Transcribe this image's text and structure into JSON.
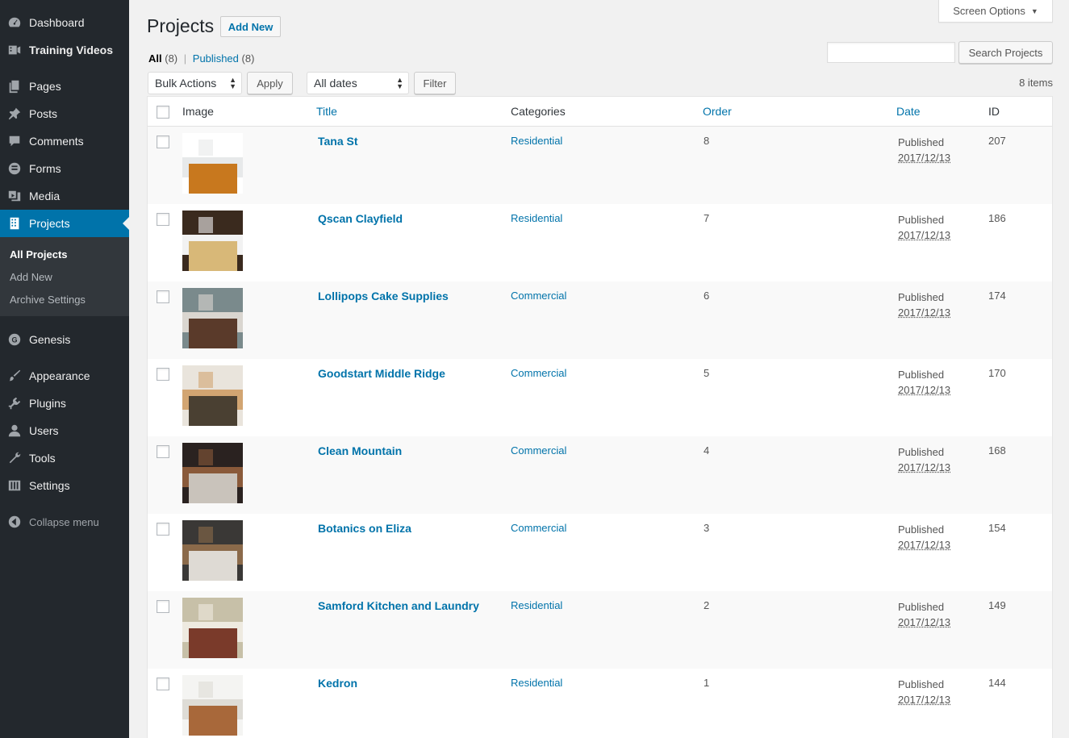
{
  "sidebar": {
    "items": [
      {
        "label": "Dashboard",
        "icon": "dashboard-icon"
      },
      {
        "label": "Training Videos",
        "icon": "video-icon"
      },
      {
        "label": "Pages",
        "icon": "pages-icon"
      },
      {
        "label": "Posts",
        "icon": "pin-icon"
      },
      {
        "label": "Comments",
        "icon": "comment-icon"
      },
      {
        "label": "Forms",
        "icon": "forms-icon"
      },
      {
        "label": "Media",
        "icon": "media-icon"
      },
      {
        "label": "Projects",
        "icon": "projects-icon"
      },
      {
        "label": "Genesis",
        "icon": "genesis-icon"
      },
      {
        "label": "Appearance",
        "icon": "brush-icon"
      },
      {
        "label": "Plugins",
        "icon": "plugin-icon"
      },
      {
        "label": "Users",
        "icon": "user-icon"
      },
      {
        "label": "Tools",
        "icon": "wrench-icon"
      },
      {
        "label": "Settings",
        "icon": "settings-icon"
      }
    ],
    "submenu": [
      "All Projects",
      "Add New",
      "Archive Settings"
    ],
    "collapse_label": "Collapse menu"
  },
  "header": {
    "title": "Projects",
    "add_new": "Add New",
    "screen_options": "Screen Options"
  },
  "filters": {
    "all_label": "All",
    "all_count": "(8)",
    "sep": "|",
    "published_label": "Published",
    "published_count": "(8)"
  },
  "search": {
    "placeholder": "",
    "button": "Search Projects"
  },
  "toolbar": {
    "bulk_actions": "Bulk Actions",
    "apply": "Apply",
    "dates": "All dates",
    "filter": "Filter",
    "items_count": "8 items"
  },
  "columns": {
    "image": "Image",
    "title": "Title",
    "categories": "Categories",
    "order": "Order",
    "date": "Date",
    "id": "ID"
  },
  "rows": [
    {
      "title": "Tana St",
      "category": "Residential",
      "order": "8",
      "status": "Published",
      "date": "2017/12/13",
      "id": "207",
      "palette": [
        "#ffffff",
        "#e7e9ea",
        "#c8781e"
      ]
    },
    {
      "title": "Qscan Clayfield",
      "category": "Residential",
      "order": "7",
      "status": "Published",
      "date": "2017/12/13",
      "id": "186",
      "palette": [
        "#3a2a1e",
        "#f2f2f2",
        "#d8b878"
      ]
    },
    {
      "title": "Lollipops Cake Supplies",
      "category": "Commercial",
      "order": "6",
      "status": "Published",
      "date": "2017/12/13",
      "id": "174",
      "palette": [
        "#7a8a8c",
        "#dad6d0",
        "#5a3a2a"
      ]
    },
    {
      "title": "Goodstart Middle Ridge",
      "category": "Commercial",
      "order": "5",
      "status": "Published",
      "date": "2017/12/13",
      "id": "170",
      "palette": [
        "#e9e4dc",
        "#d2a572",
        "#4a4032"
      ]
    },
    {
      "title": "Clean Mountain",
      "category": "Commercial",
      "order": "4",
      "status": "Published",
      "date": "2017/12/13",
      "id": "168",
      "palette": [
        "#2a2220",
        "#8a5a3a",
        "#c9c3bb"
      ]
    },
    {
      "title": "Botanics on Eliza",
      "category": "Commercial",
      "order": "3",
      "status": "Published",
      "date": "2017/12/13",
      "id": "154",
      "palette": [
        "#3a3836",
        "#8b6a4a",
        "#dedad4"
      ]
    },
    {
      "title": "Samford Kitchen and Laundry",
      "category": "Residential",
      "order": "2",
      "status": "Published",
      "date": "2017/12/13",
      "id": "149",
      "palette": [
        "#c7c0a8",
        "#eeeae0",
        "#7a3a2a"
      ]
    },
    {
      "title": "Kedron",
      "category": "Residential",
      "order": "1",
      "status": "Published",
      "date": "2017/12/13",
      "id": "144",
      "palette": [
        "#f4f4f2",
        "#dedcd6",
        "#a8683a"
      ]
    }
  ]
}
